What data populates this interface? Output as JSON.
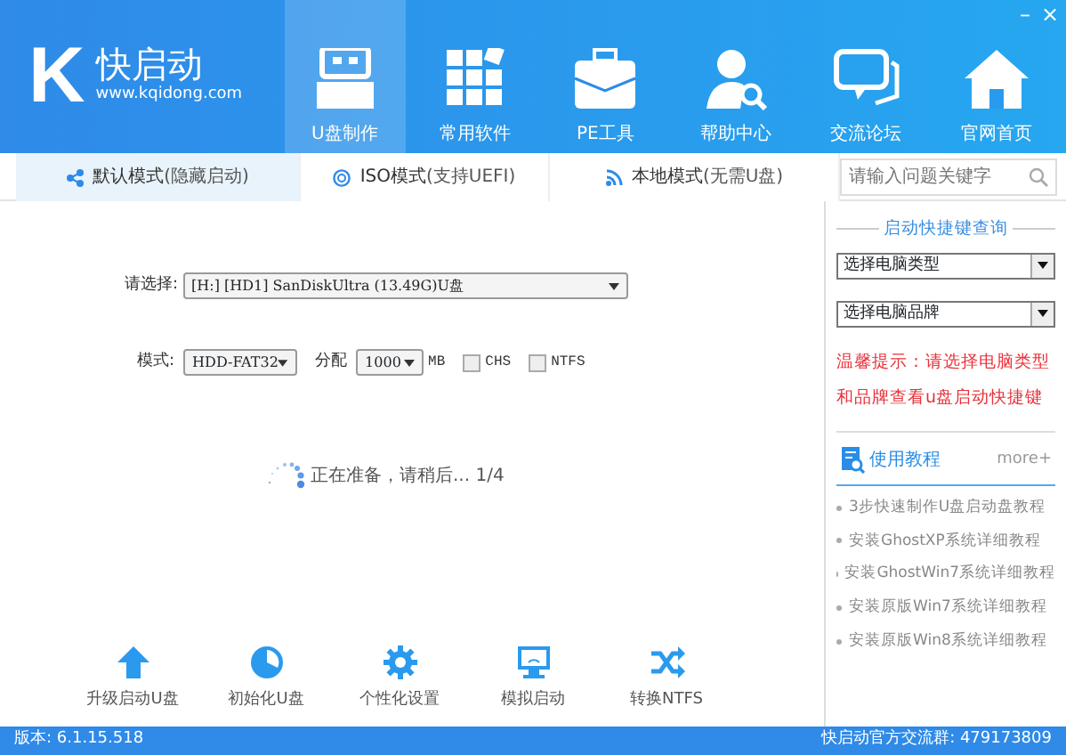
{
  "window": {
    "controls": [
      "–",
      "×"
    ]
  },
  "logo": {
    "letter": "K",
    "name": "快启动",
    "url": "www.kqidong.com"
  },
  "nav": [
    {
      "label": "U盘制作",
      "selected": true
    },
    {
      "label": "常用软件",
      "selected": false
    },
    {
      "label": "PE工具",
      "selected": false
    },
    {
      "label": "帮助中心",
      "selected": false
    },
    {
      "label": "交流论坛",
      "selected": false
    },
    {
      "label": "官网首页",
      "selected": false
    }
  ],
  "mode_tabs": [
    {
      "label": "默认模式",
      "note": "(隐藏启动)",
      "selected": true
    },
    {
      "label": "ISO模式",
      "note": "(支持UEFI)",
      "selected": false
    },
    {
      "label": "本地模式",
      "note": "(无需U盘)",
      "selected": false
    }
  ],
  "form": {
    "device_label": "请选择:",
    "device_value": "[H:] [HD1] SanDiskUltra (13.49G)U盘",
    "mode_label": "模式:",
    "mode_value": "HDD-FAT32",
    "alloc_label": "分配",
    "alloc_value": "1000",
    "alloc_unit": "MB",
    "options": [
      {
        "label": "CHS",
        "checked": false
      },
      {
        "label": "NTFS",
        "checked": false
      }
    ]
  },
  "progress": {
    "text": "正在准备，请稍后... 1/4"
  },
  "tools": [
    "升级启动U盘",
    "初始化U盘",
    "个性化设置",
    "模拟启动",
    "转换NTFS"
  ],
  "sidebar": {
    "search_placeholder": "请输入问题关键字",
    "hotkey_title": "启动快捷键查询",
    "selects": [
      "选择电脑类型",
      "选择电脑品牌"
    ],
    "tip": "温馨提示：请选择电脑类型和品牌查看u盘启动快捷键",
    "tutorial_title": "使用教程",
    "more": "more+",
    "tutorials": [
      "3步快速制作U盘启动盘教程",
      "安装GhostXP系统详细教程",
      "安装GhostWin7系统详细教程",
      "安装原版Win7系统详细教程",
      "安装原版Win8系统详细教程"
    ]
  },
  "status_bar": {
    "version": "版本: 6.1.15.518",
    "group": "快启动官方交流群: 479173809"
  }
}
